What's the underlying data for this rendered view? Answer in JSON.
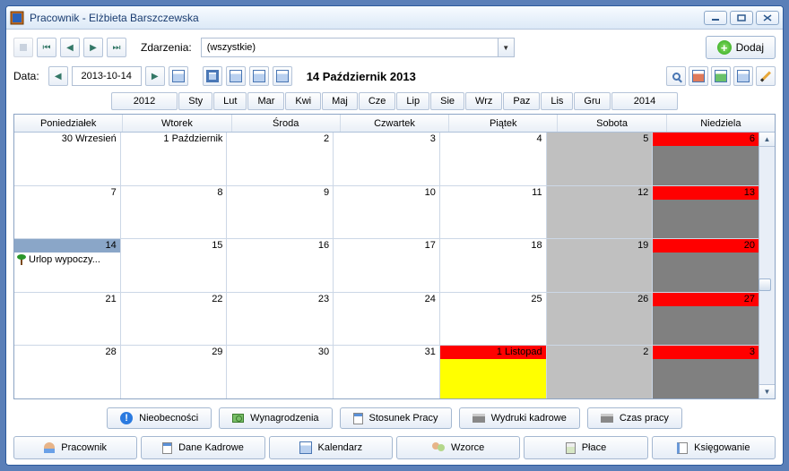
{
  "window": {
    "title": "Pracownik - Elżbieta Barszczewska"
  },
  "toolbar1": {
    "events_label": "Zdarzenia:",
    "events_combo": "(wszystkie)",
    "add_label": "Dodaj"
  },
  "toolbar2": {
    "date_label": "Data:",
    "date_value": "2013-10-14",
    "date_header": "14 Październik 2013"
  },
  "monthrow": {
    "prev_year": "2012",
    "months": [
      "Sty",
      "Lut",
      "Mar",
      "Kwi",
      "Maj",
      "Cze",
      "Lip",
      "Sie",
      "Wrz",
      "Paz",
      "Lis",
      "Gru"
    ],
    "next_year": "2014"
  },
  "calendar": {
    "headers": [
      "Poniedziałek",
      "Wtorek",
      "Środa",
      "Czwartek",
      "Piątek",
      "Sobota",
      "Niedziela"
    ],
    "weeks": [
      [
        {
          "label": "30 Wrzesień"
        },
        {
          "label": "1 Październik"
        },
        {
          "label": "2"
        },
        {
          "label": "3"
        },
        {
          "label": "4"
        },
        {
          "label": "5",
          "sat": true
        },
        {
          "label": "6",
          "sun": true
        }
      ],
      [
        {
          "label": "7"
        },
        {
          "label": "8"
        },
        {
          "label": "9"
        },
        {
          "label": "10"
        },
        {
          "label": "11"
        },
        {
          "label": "12",
          "sat": true
        },
        {
          "label": "13",
          "sun": true
        }
      ],
      [
        {
          "label": "14",
          "selected": true,
          "event": "Urlop wypoczy..."
        },
        {
          "label": "15"
        },
        {
          "label": "16"
        },
        {
          "label": "17"
        },
        {
          "label": "18"
        },
        {
          "label": "19",
          "sat": true
        },
        {
          "label": "20",
          "sun": true
        }
      ],
      [
        {
          "label": "21"
        },
        {
          "label": "22"
        },
        {
          "label": "23"
        },
        {
          "label": "24"
        },
        {
          "label": "25"
        },
        {
          "label": "26",
          "sat": true
        },
        {
          "label": "27",
          "sun": true
        }
      ],
      [
        {
          "label": "28"
        },
        {
          "label": "29"
        },
        {
          "label": "30"
        },
        {
          "label": "31"
        },
        {
          "label": "1 Listopad",
          "holiday": true
        },
        {
          "label": "2",
          "sat": true
        },
        {
          "label": "3",
          "sun": true
        }
      ]
    ]
  },
  "actions": {
    "absence": "Nieobecności",
    "salary": "Wynagrodzenia",
    "employment": "Stosunek Pracy",
    "hrprint": "Wydruki kadrowe",
    "worktime": "Czas pracy"
  },
  "tabs": {
    "employee": "Pracownik",
    "hrdata": "Dane Kadrowe",
    "calendar": "Kalendarz",
    "patterns": "Wzorce",
    "wages": "Płace",
    "accounting": "Księgowanie"
  }
}
